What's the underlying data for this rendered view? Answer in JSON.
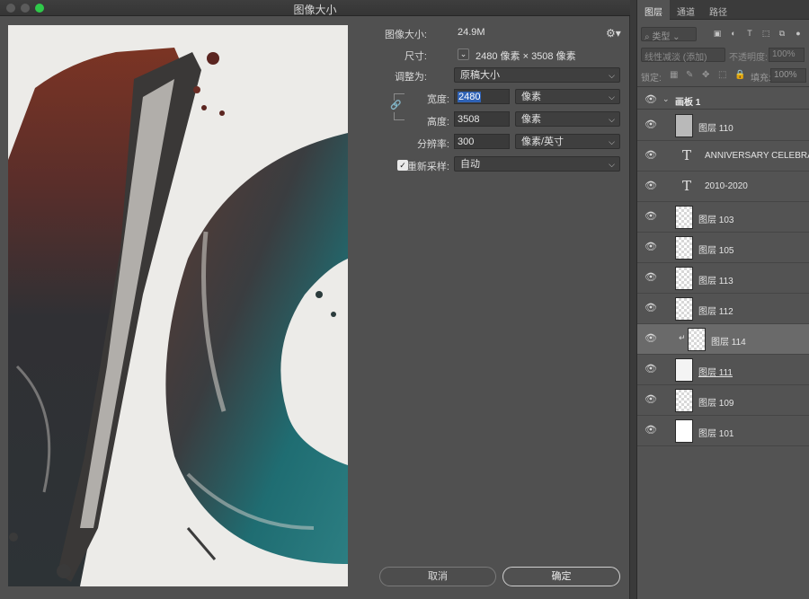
{
  "dialog": {
    "title": "图像大小",
    "image_size_label": "图像大小:",
    "image_size_value": "24.9M",
    "dimensions_label": "尺寸:",
    "dimensions_value": "2480 像素 × 3508 像素",
    "fit_to_label": "调整为:",
    "fit_to_value": "原稿大小",
    "width_label": "宽度:",
    "width_value": "2480",
    "width_unit": "像素",
    "height_label": "高度:",
    "height_value": "3508",
    "height_unit": "像素",
    "resolution_label": "分辨率:",
    "resolution_value": "300",
    "resolution_unit": "像素/英寸",
    "resample_label": "重新采样:",
    "resample_checked": true,
    "resample_value": "自动",
    "cancel_label": "取消",
    "ok_label": "确定",
    "accent": "#2fc94a"
  },
  "layers_panel": {
    "tabs": [
      "图层",
      "通道",
      "路径"
    ],
    "filter_placeholder": "类型",
    "blend_mode": "线性减淡 (添加)",
    "opacity_label": "不透明度:",
    "opacity_value": "100%",
    "lock_label": "锁定:",
    "fill_label": "填充:",
    "fill_value": "100%",
    "group_name": "画板 1",
    "layers": [
      {
        "name": "图层 110",
        "type": "pixel"
      },
      {
        "name": "ANNIVERSARY  CELEBRAT",
        "type": "text"
      },
      {
        "name": "2010-2020",
        "type": "text"
      },
      {
        "name": "图层 103",
        "type": "pixel"
      },
      {
        "name": "图层 105",
        "type": "pixel"
      },
      {
        "name": "图层 113",
        "type": "pixel"
      },
      {
        "name": "图层 112",
        "type": "pixel"
      },
      {
        "name": "图层 114",
        "type": "pixel",
        "selected": true,
        "clipped": true
      },
      {
        "name": "图层 111",
        "type": "pixel",
        "underline": true
      },
      {
        "name": "图层 109",
        "type": "pixel"
      },
      {
        "name": "图层 101",
        "type": "pixel"
      }
    ]
  }
}
